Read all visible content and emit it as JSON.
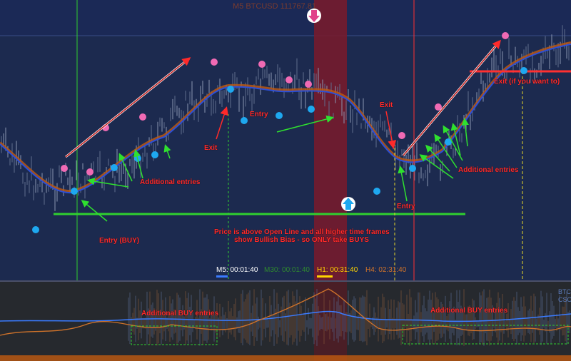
{
  "title": "M5 BTCUSD 111767.81",
  "timeframes": [
    {
      "label": "M5: 00:01:40",
      "color": "#ffffff",
      "bar": "#3a7bff"
    },
    {
      "label": "M30: 00:01:40",
      "color": "#2f8a2f",
      "bar": "#2f8a2f"
    },
    {
      "label": "H1: 00:31:40",
      "color": "#ffd400",
      "bar": "#ffd400"
    },
    {
      "label": "H4: 02:31:40",
      "color": "#d0732a",
      "bar": "#d0732a"
    }
  ],
  "annotations": {
    "entry_buy": "Entry (BUY)",
    "additional_entries_1": "Additional entries",
    "exit_1": "Exit",
    "entry_2": "Entry",
    "exit_2": "Exit",
    "entry_3": "Entry",
    "additional_entries_2": "Additional entries",
    "exit_if_you_want": "Exit (if you want to)",
    "bias_line1": "Price is above Open Line and all higher time frames",
    "bias_line2": "show Bullish Bias - so ONLY take BUYS",
    "additional_buy_entries_1": "Additional BUY entries",
    "additional_buy_entries_2": "Additional BUY entries"
  },
  "indicator_label_1": "BTC",
  "indicator_label_2": "CSC",
  "colors": {
    "chart_bg": "#1c2a4f",
    "indicator_bg": "#26292e",
    "session_highlight": "#7a1a2a",
    "open_line": "#2fd02f",
    "buy_dot": "#1ea8f0",
    "sell_dot": "#f06ab4",
    "ma_line": "#2b4fd8",
    "ma_shadow": "#c05a10",
    "annotation_text": "#ff2a2a",
    "entry_line": "#2fd02f",
    "exit_line": "#ff3030",
    "session_line": "#e8d82a"
  }
}
